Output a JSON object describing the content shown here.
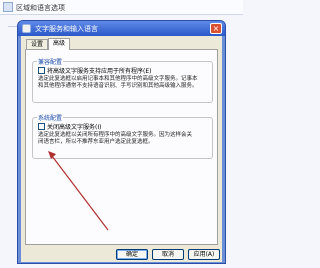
{
  "outer_window": {
    "title": "区域和语言选项"
  },
  "dialog": {
    "title": "文字服务和输入语言",
    "close_glyph": "×",
    "tabs": [
      {
        "label": "设置"
      },
      {
        "label": "高级"
      }
    ],
    "compat_group": {
      "label": "兼容配置",
      "checkbox_label": "将高级文字服务支持应用于所有程序(E)",
      "checked": false,
      "description": "选定此复选框以启用记事本和其他程序中的高级文字服务。记事本\n和其他程序通常不支持语音识别、手写识别和其他高级输入服务。"
    },
    "system_group": {
      "label": "系统配置",
      "checkbox_label": "关闭高级文字服务(I)",
      "checked": false,
      "description": "选定此复选框以关闭所有程序中的高级文字服务。因为这样会关\n闭语言栏，所以不推荐东亚用户选定此复选框。"
    },
    "buttons": {
      "ok": "确定",
      "cancel": "取消",
      "apply": "应用(A)"
    }
  },
  "annotation": {
    "color": "#b03030"
  }
}
